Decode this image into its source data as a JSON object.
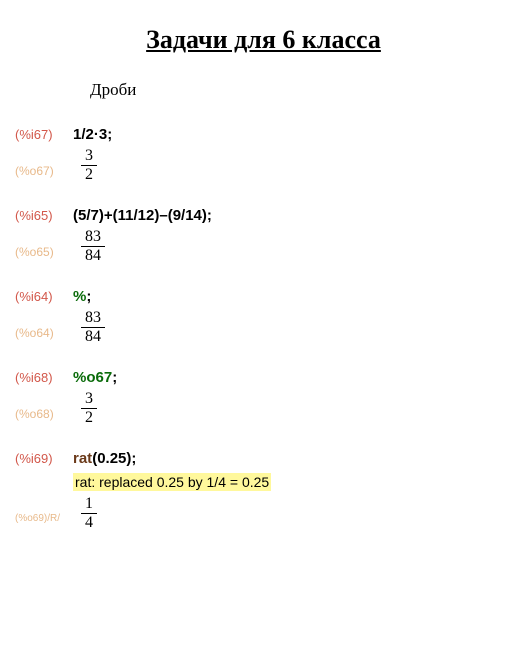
{
  "title": "Задачи для 6 класса",
  "subtitle": "Дроби",
  "cells": [
    {
      "in_label": "(%i67)",
      "expr_parts": [
        {
          "t": "num",
          "v": "1"
        },
        {
          "t": "op",
          "v": "/"
        },
        {
          "t": "num",
          "v": "2"
        },
        {
          "t": "op",
          "v": "·"
        },
        {
          "t": "num",
          "v": "3"
        },
        {
          "t": "op",
          "v": ";"
        }
      ],
      "out_label": "(%o67)",
      "frac": {
        "top": "3",
        "bot": "2"
      }
    },
    {
      "in_label": "(%i65)",
      "expr_parts": [
        {
          "t": "paren",
          "v": "("
        },
        {
          "t": "num",
          "v": "5"
        },
        {
          "t": "op",
          "v": "/"
        },
        {
          "t": "num",
          "v": "7"
        },
        {
          "t": "paren",
          "v": ")"
        },
        {
          "t": "op",
          "v": "+"
        },
        {
          "t": "paren",
          "v": "("
        },
        {
          "t": "num",
          "v": "11"
        },
        {
          "t": "op",
          "v": "/"
        },
        {
          "t": "num",
          "v": "12"
        },
        {
          "t": "paren",
          "v": ")"
        },
        {
          "t": "op",
          "v": "–"
        },
        {
          "t": "paren",
          "v": "("
        },
        {
          "t": "num",
          "v": "9"
        },
        {
          "t": "op",
          "v": "/"
        },
        {
          "t": "num",
          "v": "14"
        },
        {
          "t": "paren",
          "v": ")"
        },
        {
          "t": "op",
          "v": ";"
        }
      ],
      "out_label": "(%o65)",
      "frac": {
        "top": "83",
        "bot": "84"
      }
    },
    {
      "in_label": "(%i64)",
      "expr_parts": [
        {
          "t": "pct",
          "v": "%"
        },
        {
          "t": "op",
          "v": ";"
        }
      ],
      "out_label": "(%o64)",
      "frac": {
        "top": "83",
        "bot": "84"
      }
    },
    {
      "in_label": "(%i68)",
      "expr_parts": [
        {
          "t": "oref",
          "v": "%o67"
        },
        {
          "t": "op",
          "v": ";"
        }
      ],
      "out_label": "(%o68)",
      "frac": {
        "top": "3",
        "bot": "2"
      }
    },
    {
      "in_label": "(%i69)",
      "expr_parts": [
        {
          "t": "fn",
          "v": "rat"
        },
        {
          "t": "paren",
          "v": "("
        },
        {
          "t": "num",
          "v": "0.25"
        },
        {
          "t": "paren",
          "v": ")"
        },
        {
          "t": "op",
          "v": ";"
        }
      ],
      "msg": "rat: replaced 0.25 by 1/4 = 0.25",
      "out_label": "(%o69)/R/",
      "out_label_small": true,
      "frac": {
        "top": "1",
        "bot": "4"
      }
    }
  ]
}
